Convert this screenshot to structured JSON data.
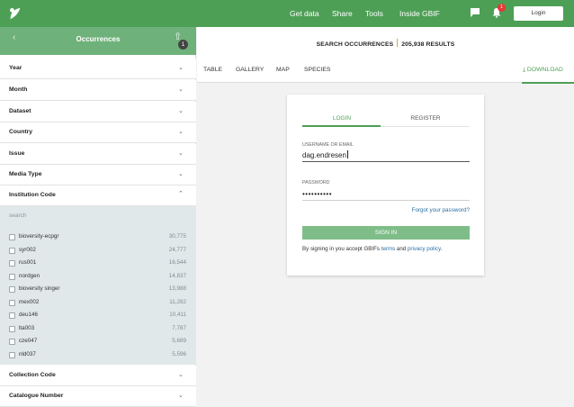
{
  "topbar": {
    "nav": [
      "Get data",
      "Share",
      "Tools",
      "Inside GBIF"
    ],
    "notification_count": "1",
    "login_label": "Login",
    "brand_color": "#4e9f56",
    "icons": [
      "gbif-logo-icon",
      "chat-icon",
      "bell-icon"
    ]
  },
  "sidebar": {
    "title": "Occurrences",
    "filter_count": "1",
    "facets_top": [
      "Year",
      "Month",
      "Dataset",
      "Country",
      "Issue",
      "Media Type"
    ],
    "institution": {
      "label": "Institution Code",
      "search_placeholder": "search",
      "items": [
        {
          "name": "bioversity-ecpgr",
          "count": "30,775"
        },
        {
          "name": "syr002",
          "count": "24,777"
        },
        {
          "name": "rus001",
          "count": "16,544"
        },
        {
          "name": "nordgen",
          "count": "14,837"
        },
        {
          "name": "bioversity singer",
          "count": "13,988"
        },
        {
          "name": "mex002",
          "count": "11,282"
        },
        {
          "name": "deu146",
          "count": "10,411"
        },
        {
          "name": "lta003",
          "count": "7,787"
        },
        {
          "name": "cze047",
          "count": "5,689"
        },
        {
          "name": "nld037",
          "count": "5,596"
        }
      ]
    },
    "facets_bottom": [
      "Collection Code",
      "Catalogue Number"
    ]
  },
  "main": {
    "search_label": "SEARCH OCCURRENCES",
    "results_label": "205,938 RESULTS",
    "tabs": [
      "TABLE",
      "GALLERY",
      "MAP",
      "SPECIES"
    ],
    "download_label": "DOWNLOAD"
  },
  "login": {
    "tab_login": "LOGIN",
    "tab_register": "REGISTER",
    "username_label": "USERNAME OR EMAIL",
    "username_value": "dag.endresen",
    "password_label": "PASSWORD",
    "password_value": "••••••••••",
    "forgot_label": "Forgot your password?",
    "signin_label": "SIGN IN",
    "terms_prefix": "By signing in you accept GBIFs",
    "terms_link": "terms",
    "terms_and": "and",
    "privacy_link": "privacy policy",
    "terms_suffix": "."
  }
}
